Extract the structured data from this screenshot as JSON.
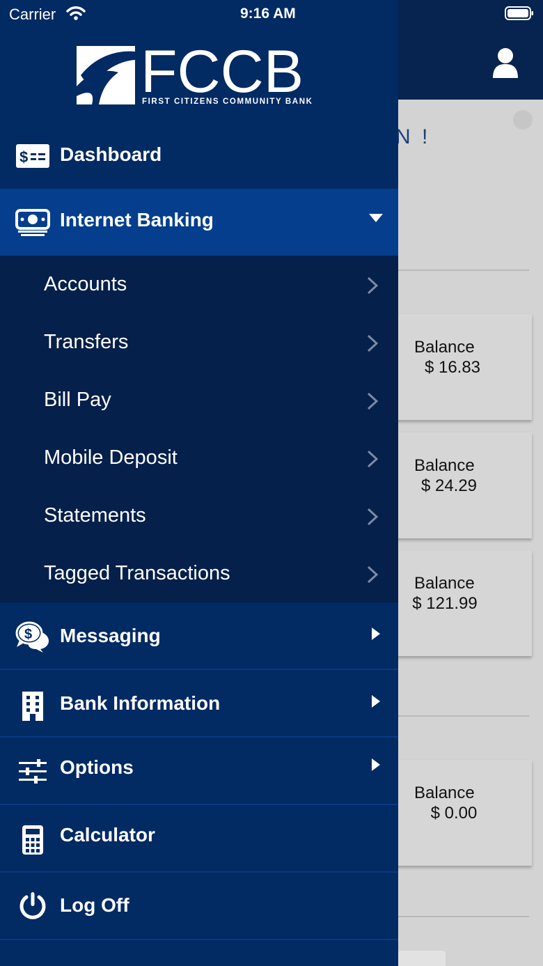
{
  "status_bar": {
    "carrier": "Carrier",
    "time": "9:16 AM"
  },
  "background": {
    "greeting_partial": "N !",
    "cards": [
      {
        "label": "Balance",
        "value": "$ 16.83"
      },
      {
        "label": "Balance",
        "value": "$ 24.29"
      },
      {
        "label": "Balance",
        "value": "$ 121.99"
      },
      {
        "label": "Balance",
        "value": "$ 0.00"
      }
    ]
  },
  "drawer": {
    "logo": {
      "name": "FCCB",
      "tagline": "FIRST CITIZENS COMMUNITY BANK"
    },
    "menu": {
      "dashboard": "Dashboard",
      "internet_banking": "Internet Banking",
      "messaging": "Messaging",
      "bank_information": "Bank Information",
      "options": "Options",
      "calculator": "Calculator",
      "log_off": "Log Off"
    },
    "submenu": [
      "Accounts",
      "Transfers",
      "Bill Pay",
      "Mobile Deposit",
      "Statements",
      "Tagged Transactions"
    ]
  },
  "icons": {
    "dashboard": "money-bill-icon",
    "internet_banking": "money-stack-icon",
    "messaging": "chat-dollar-icon",
    "bank_information": "building-icon",
    "options": "sliders-icon",
    "calculator": "calculator-icon",
    "log_off": "power-icon"
  },
  "colors": {
    "drawer": "#022a63",
    "active_row": "#043e8c",
    "submenu": "#05204a",
    "header": "#07234f"
  }
}
